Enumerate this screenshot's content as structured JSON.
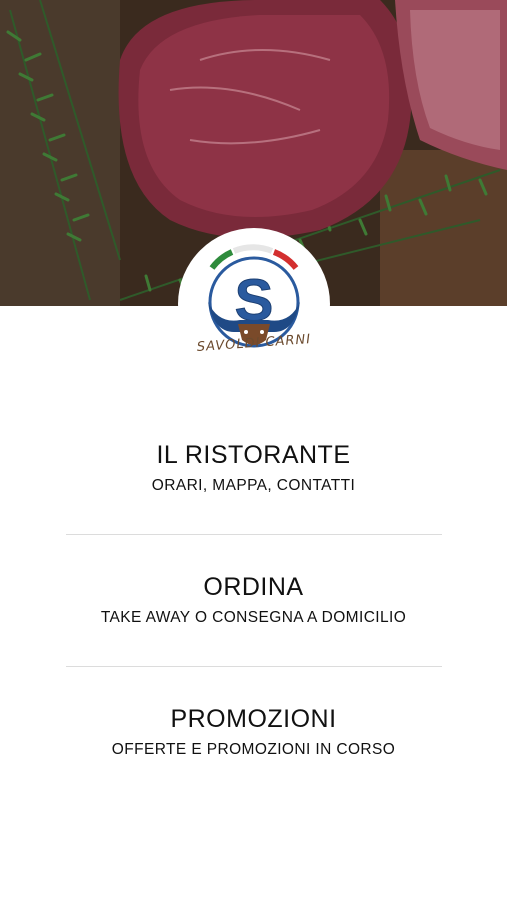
{
  "hero": {
    "image": "raw-meat-with-rosemary-photo"
  },
  "logo": {
    "brand_text": "SAVOLDI CARNI",
    "flag_colors": [
      "#2e8b3c",
      "#ffffff",
      "#d32f2f"
    ],
    "accent": "#2a5a9e",
    "bull_color": "#7a4a2a"
  },
  "menu": [
    {
      "title": "IL RISTORANTE",
      "subtitle": "ORARI, MAPPA, CONTATTI"
    },
    {
      "title": "ORDINA",
      "subtitle": "TAKE AWAY O CONSEGNA A DOMICILIO"
    },
    {
      "title": "PROMOZIONI",
      "subtitle": "OFFERTE E PROMOZIONI IN CORSO"
    }
  ]
}
